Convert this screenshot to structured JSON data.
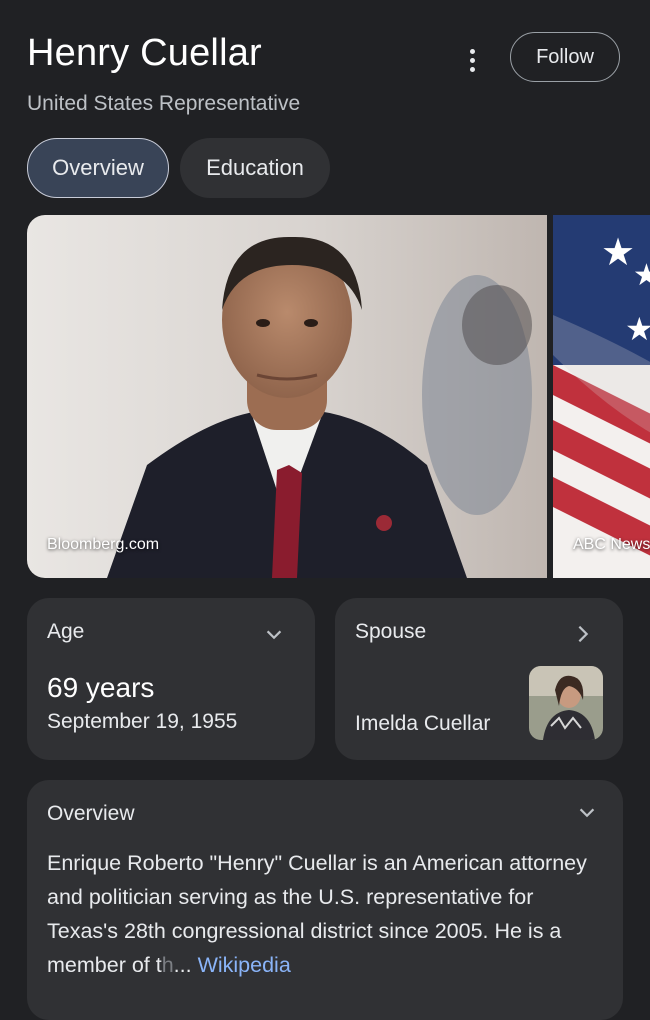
{
  "header": {
    "title": "Henry Cuellar",
    "subtitle": "United States Representative",
    "follow_label": "Follow",
    "menu_icon": "more-vert-icon"
  },
  "tabs": [
    {
      "label": "Overview",
      "active": true
    },
    {
      "label": "Education",
      "active": false
    }
  ],
  "images": [
    {
      "source": "Bloomberg.com"
    },
    {
      "source": "ABC News"
    }
  ],
  "facts": {
    "age": {
      "label": "Age",
      "value": "69 years",
      "detail": "September 19, 1955",
      "icon": "chevron-down-icon"
    },
    "spouse": {
      "label": "Spouse",
      "name": "Imelda Cuellar",
      "icon": "chevron-right-icon"
    }
  },
  "overview": {
    "label": "Overview",
    "text_main": "Enrique Roberto \"Henry\" Cuellar is an American attorney and politician serving as the U.S. representative for Texas's 28th congressional district since 2005. He is a member of t",
    "text_faded": "h",
    "ellipsis": "...",
    "link": "Wikipedia",
    "icon": "chevron-down-icon"
  },
  "colors": {
    "background": "#202124",
    "card": "#303134",
    "active_tab": "#394457",
    "link": "#8ab4f8"
  }
}
